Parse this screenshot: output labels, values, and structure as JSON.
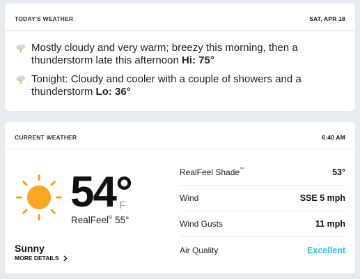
{
  "today": {
    "title": "TODAY'S WEATHER",
    "date": "SAT, APR 18",
    "forecasts": [
      {
        "icon": "thunderstorm-icon",
        "text_line1": "Mostly cloudy and very warm; breezy this morning, then a",
        "text_line2": "thunderstorm late this afternoon",
        "temp_label": "Hi: 75°"
      },
      {
        "icon": "thunderstorm-icon",
        "text_line1": "Tonight: Cloudy and cooler with a couple of showers and a",
        "text_line2": "thunderstorm",
        "temp_label": "Lo: 36°"
      }
    ]
  },
  "current": {
    "title": "CURRENT WEATHER",
    "time": "6:40 AM",
    "icon": "sun-icon",
    "temperature": "54°",
    "unit": "F",
    "realfeel_label": "RealFeel",
    "realfeel_tm": "®",
    "realfeel_value": "55°",
    "phrase": "Sunny",
    "more_details": "MORE DETAILS",
    "details": [
      {
        "label": "RealFeel Shade",
        "tm": "™",
        "value": "53°"
      },
      {
        "label": "Wind",
        "tm": "",
        "value": "SSE 5 mph"
      },
      {
        "label": "Wind Gusts",
        "tm": "",
        "value": "11 mph"
      },
      {
        "label": "Air Quality",
        "tm": "",
        "value": "Excellent"
      }
    ]
  },
  "colors": {
    "background": "#eaebf0",
    "card": "#ffffff",
    "air_quality_excellent": "#2bbfe0",
    "sun": "#f7a11a"
  }
}
